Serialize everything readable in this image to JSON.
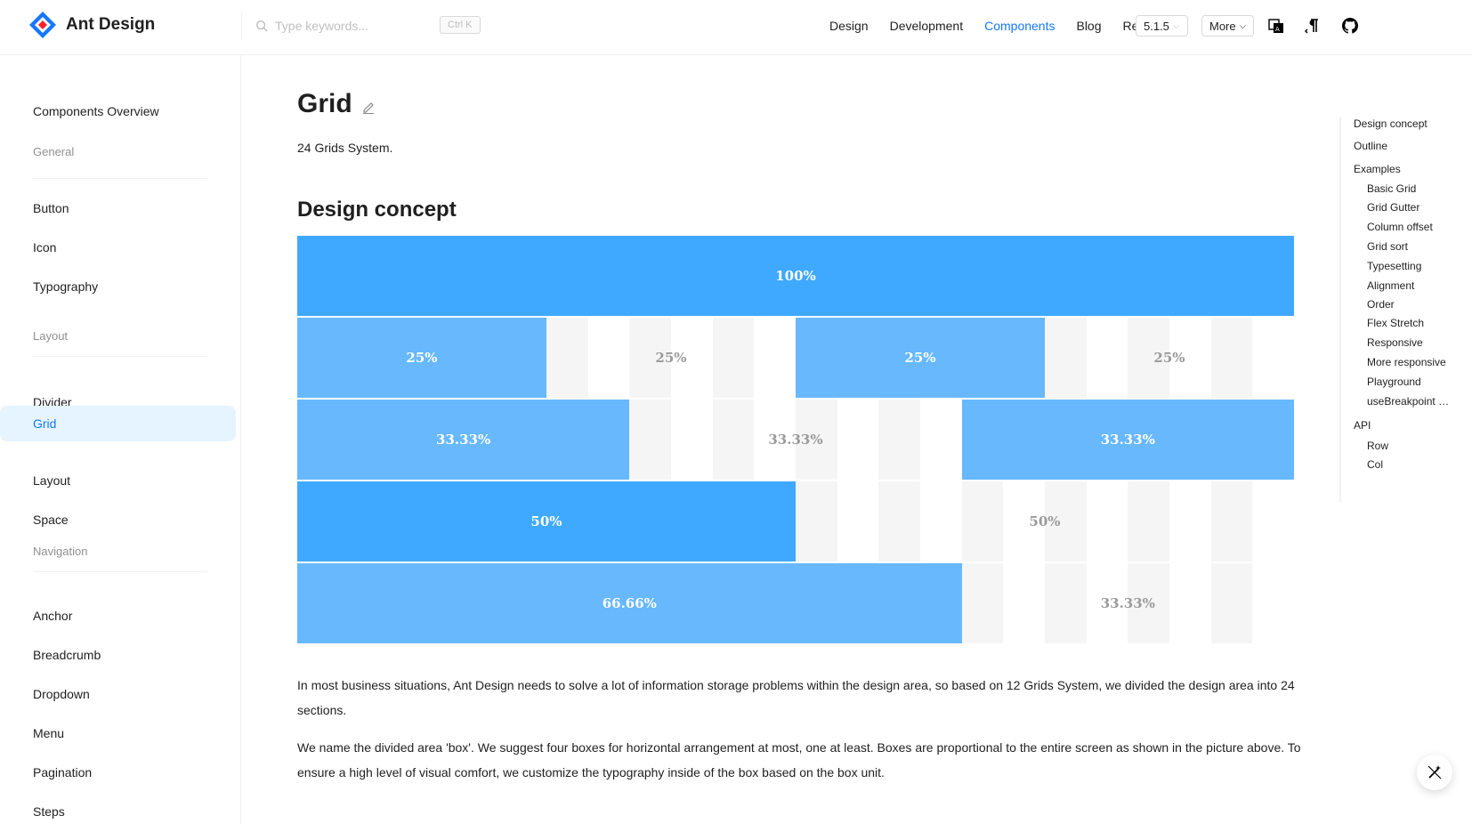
{
  "header": {
    "logo_text": "Ant Design",
    "search_placeholder": "Type keywords...",
    "search_shortcut": "Ctrl K",
    "nav": [
      {
        "label": "Design"
      },
      {
        "label": "Development"
      },
      {
        "label": "Components",
        "active": true
      },
      {
        "label": "Blog"
      },
      {
        "label": "Resources"
      }
    ],
    "version": "5.1.5",
    "more_label": "More",
    "icons": [
      "language-switch-icon",
      "direction-rtl-icon",
      "github-icon"
    ]
  },
  "sidebar": {
    "overview": "Components Overview",
    "groups": [
      {
        "title": "General",
        "items": [
          "Button",
          "Icon",
          "Typography"
        ]
      },
      {
        "title": "Layout",
        "items": [
          "Divider",
          "Grid",
          "Layout",
          "Space"
        ]
      },
      {
        "title": "Navigation",
        "items": [
          "Anchor",
          "Breadcrumb",
          "Dropdown",
          "Menu",
          "Pagination",
          "Steps"
        ]
      }
    ],
    "active_item": "Grid"
  },
  "main": {
    "title": "Grid",
    "subtitle": "24 Grids System.",
    "section_title": "Design concept",
    "grid_rows": [
      {
        "cols": [
          {
            "label": "100%",
            "span": 24,
            "style": "dark"
          }
        ]
      },
      {
        "cols": [
          {
            "label": "25%",
            "span": 6,
            "style": "light"
          },
          {
            "label": "25%",
            "span": 6,
            "style": "empty"
          },
          {
            "label": "25%",
            "span": 6,
            "style": "light"
          },
          {
            "label": "25%",
            "span": 6,
            "style": "empty"
          }
        ]
      },
      {
        "cols": [
          {
            "label": "33.33%",
            "span": 8,
            "style": "light"
          },
          {
            "label": "33.33%",
            "span": 8,
            "style": "empty"
          },
          {
            "label": "33.33%",
            "span": 8,
            "style": "light"
          }
        ]
      },
      {
        "cols": [
          {
            "label": "50%",
            "span": 12,
            "style": "dark"
          },
          {
            "label": "50%",
            "span": 12,
            "style": "empty"
          }
        ]
      },
      {
        "cols": [
          {
            "label": "66.66%",
            "span": 16,
            "style": "light"
          },
          {
            "label": "33.33%",
            "span": 8,
            "style": "empty"
          }
        ]
      }
    ],
    "paragraph_1": "In most business situations, Ant Design needs to solve a lot of information storage problems within the design area, so based on 12 Grids System, we divided the design area into 24 sections.",
    "paragraph_2": "We name the divided area 'box'. We suggest four boxes for horizontal arrangement at most, one at least. Boxes are proportional to the entire screen as shown in the picture above. To ensure a high level of visual comfort, we customize the typography inside of the box based on the box unit."
  },
  "toc": {
    "items": [
      {
        "label": "Design concept",
        "level": 1
      },
      {
        "label": "Outline",
        "level": 1
      },
      {
        "label": "Examples",
        "level": 1
      },
      {
        "label": "Basic Grid",
        "level": 2
      },
      {
        "label": "Grid Gutter",
        "level": 2
      },
      {
        "label": "Column offset",
        "level": 2
      },
      {
        "label": "Grid sort",
        "level": 2
      },
      {
        "label": "Typesetting",
        "level": 2
      },
      {
        "label": "Alignment",
        "level": 2
      },
      {
        "label": "Order",
        "level": 2
      },
      {
        "label": "Flex Stretch",
        "level": 2
      },
      {
        "label": "Responsive",
        "level": 2
      },
      {
        "label": "More responsive",
        "level": 2
      },
      {
        "label": "Playground",
        "level": 2
      },
      {
        "label": "useBreakpoint Hook",
        "level": 2
      },
      {
        "label": "API",
        "level": 1
      },
      {
        "label": "Row",
        "level": 2
      },
      {
        "label": "Col",
        "level": 2
      }
    ]
  },
  "colors": {
    "primary": "#1677ff",
    "grid_dark": "#3fa9ff",
    "grid_light": "#67b8fd",
    "stripe": "#f5f5f5"
  }
}
